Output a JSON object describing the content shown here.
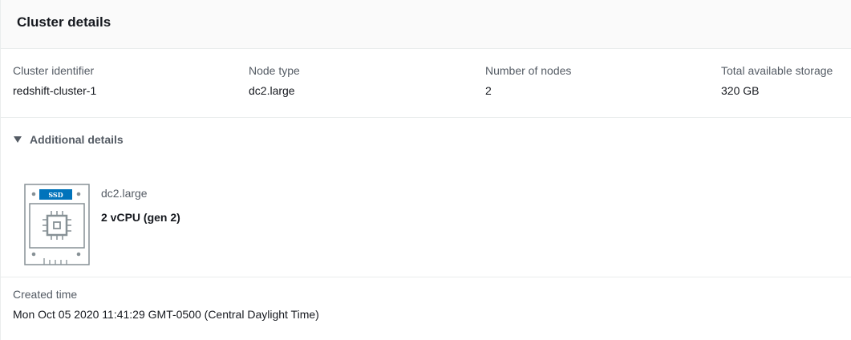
{
  "panel": {
    "title": "Cluster details"
  },
  "fields": [
    {
      "label": "Cluster identifier",
      "value": "redshift-cluster-1"
    },
    {
      "label": "Node type",
      "value": "dc2.large"
    },
    {
      "label": "Number of nodes",
      "value": "2"
    },
    {
      "label": "Total available storage",
      "value": "320 GB"
    }
  ],
  "additional": {
    "label": "Additional details",
    "expanded": true,
    "node": {
      "badge": "SSD",
      "icon": "ssd-node-icon",
      "name": "dc2.large",
      "cpu": "2 vCPU (gen 2)"
    }
  },
  "created": {
    "label": "Created time",
    "value": "Mon Oct 05 2020 11:41:29 GMT-0500 (Central Daylight Time)"
  },
  "colors": {
    "badge_blue": "#0073bb",
    "icon_gray": "#879196",
    "border": "#eaeded",
    "label_gray": "#545b64"
  }
}
